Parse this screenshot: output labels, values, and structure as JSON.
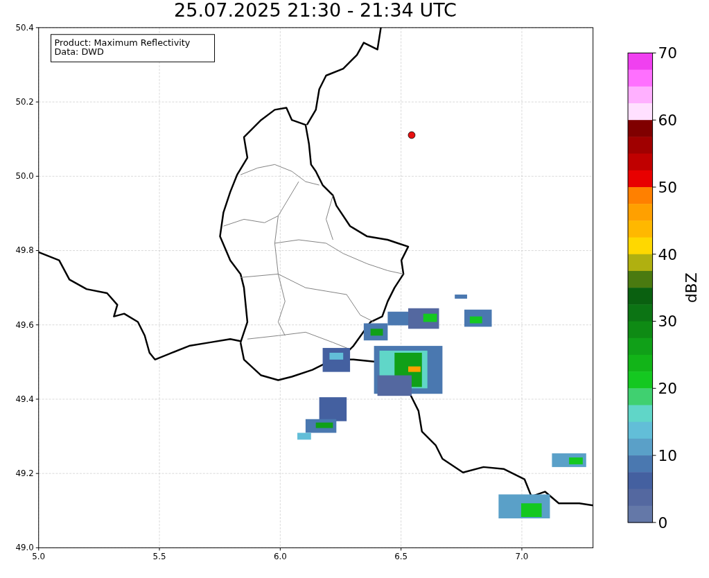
{
  "title": "25.07.2025 21:30 - 21:34 UTC",
  "info_box": {
    "lines": [
      "Product: Maximum Reflectivity",
      "Data: DWD"
    ]
  },
  "x_axis": {
    "ticks": [
      "5.0",
      "5.5",
      "6.0",
      "6.5",
      "7.0"
    ]
  },
  "y_axis": {
    "ticks": [
      "50.4",
      "50.2",
      "50.0",
      "49.8",
      "49.6",
      "49.4",
      "49.2",
      "49.0"
    ]
  },
  "colorbar": {
    "label": "dBZ",
    "ticks": [
      "70",
      "60",
      "50",
      "40",
      "30",
      "20",
      "10",
      "0"
    ],
    "segments": [
      {
        "color": "#f040f0"
      },
      {
        "color": "#ff70ff"
      },
      {
        "color": "#ffb0ff"
      },
      {
        "color": "#ffe0ff"
      },
      {
        "color": "#800000"
      },
      {
        "color": "#a00000"
      },
      {
        "color": "#c00000"
      },
      {
        "color": "#e80000"
      },
      {
        "color": "#ff8000"
      },
      {
        "color": "#ffa000"
      },
      {
        "color": "#ffb800"
      },
      {
        "color": "#ffd800"
      },
      {
        "color": "#b0b010"
      },
      {
        "color": "#4a7a10"
      },
      {
        "color": "#0a6010"
      },
      {
        "color": "#0c7414"
      },
      {
        "color": "#0e8a14"
      },
      {
        "color": "#10a018"
      },
      {
        "color": "#12b418"
      },
      {
        "color": "#14c820"
      },
      {
        "color": "#40d070"
      },
      {
        "color": "#60d6c8"
      },
      {
        "color": "#62bed8"
      },
      {
        "color": "#5aa0c8"
      },
      {
        "color": "#4a78b0"
      },
      {
        "color": "#4460a0"
      },
      {
        "color": "#5468a0"
      },
      {
        "color": "#6478a8"
      }
    ]
  }
}
